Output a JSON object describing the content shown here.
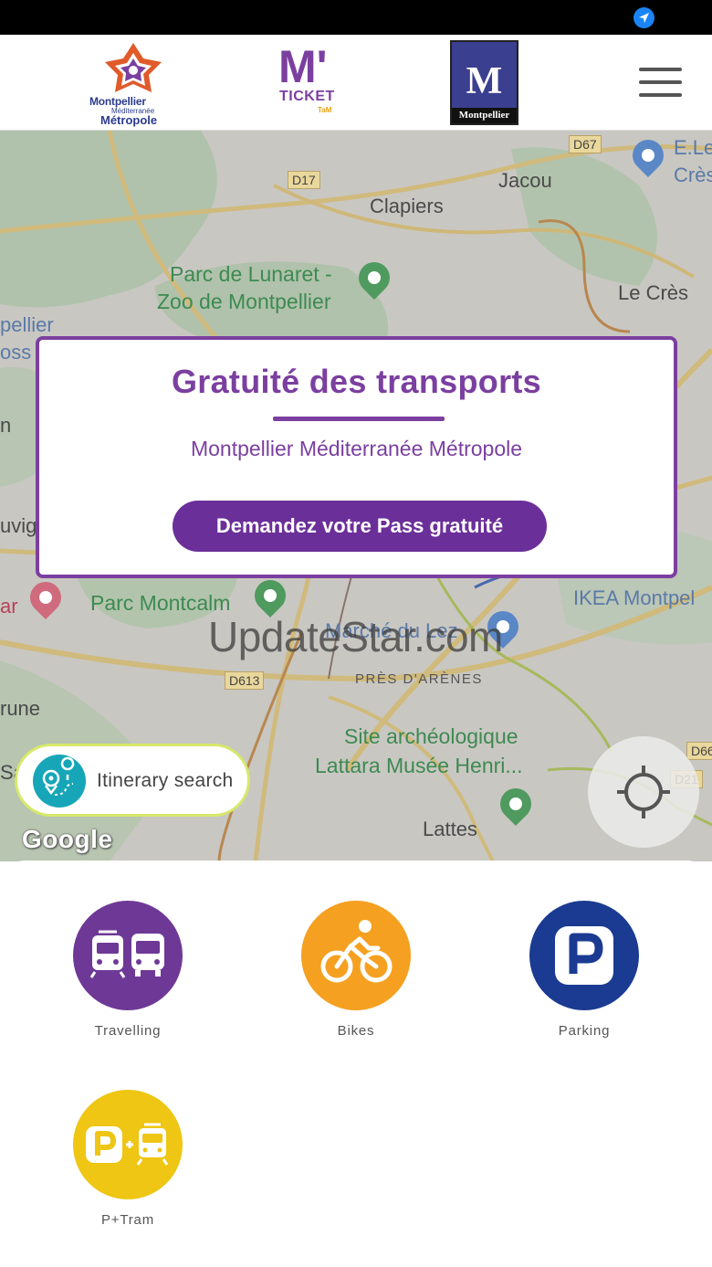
{
  "status_bar": {
    "icon": "location-arrow-icon",
    "accent": "#1a84f5"
  },
  "header": {
    "logo_mmm": {
      "line1": "Montpellier",
      "line2": "Méditerranée",
      "line3": "Métropole"
    },
    "logo_mticket": {
      "mark": "M'",
      "word": "TICKET",
      "tam": "TaM"
    },
    "logo_montpellier": {
      "letter": "M",
      "label": "Montpellier"
    },
    "menu_icon": "hamburger-menu-icon"
  },
  "map": {
    "labels": {
      "jacou": "Jacou",
      "clapiers": "Clapiers",
      "zoo_1": "Parc de Lunaret -",
      "zoo_2": "Zoo de Montpellier",
      "le_cres": "Le Crès",
      "ele_1": "E.Le",
      "ele_2": "Crès",
      "mpellier": "pellier",
      "oss": "oss",
      "uvig": "uvig",
      "ar": "ar",
      "parc_montcalm": "Parc Montcalm",
      "marche_du_lez": "Marché du Lez",
      "ikea": "IKEA Montpel",
      "pres_arenes": "PRÈS D'ARÈNES",
      "rune": "rune",
      "sa": "Sa",
      "site_1": "Site archéologique",
      "site_2": "Lattara Musée Henri...",
      "lattes": "Lattes",
      "n": "n"
    },
    "roads": {
      "d67": "D67",
      "d17": "D17",
      "d613": "D613",
      "d66": "D66",
      "d21": "D21"
    },
    "watermark": "UpdateStar.com",
    "google": "Google"
  },
  "promo": {
    "title": "Gratuité des transports",
    "subtitle": "Montpellier Méditerranée Métropole",
    "cta": "Demandez votre Pass gratuité",
    "color": "#7b3fa0"
  },
  "itinerary": {
    "label": "Itinerary search",
    "icon": "route-pin-icon"
  },
  "locate": {
    "icon": "crosshair-locate-icon"
  },
  "services": [
    {
      "label": "Travelling",
      "color": "#6e3996",
      "icon": "tram-bus-icon"
    },
    {
      "label": "Bikes",
      "color": "#f5a020",
      "icon": "bicycle-icon"
    },
    {
      "label": "Parking",
      "color": "#1a3b91",
      "icon": "parking-icon"
    },
    {
      "label": "P+Tram",
      "color": "#eec613",
      "icon": "park-and-ride-icon"
    }
  ]
}
